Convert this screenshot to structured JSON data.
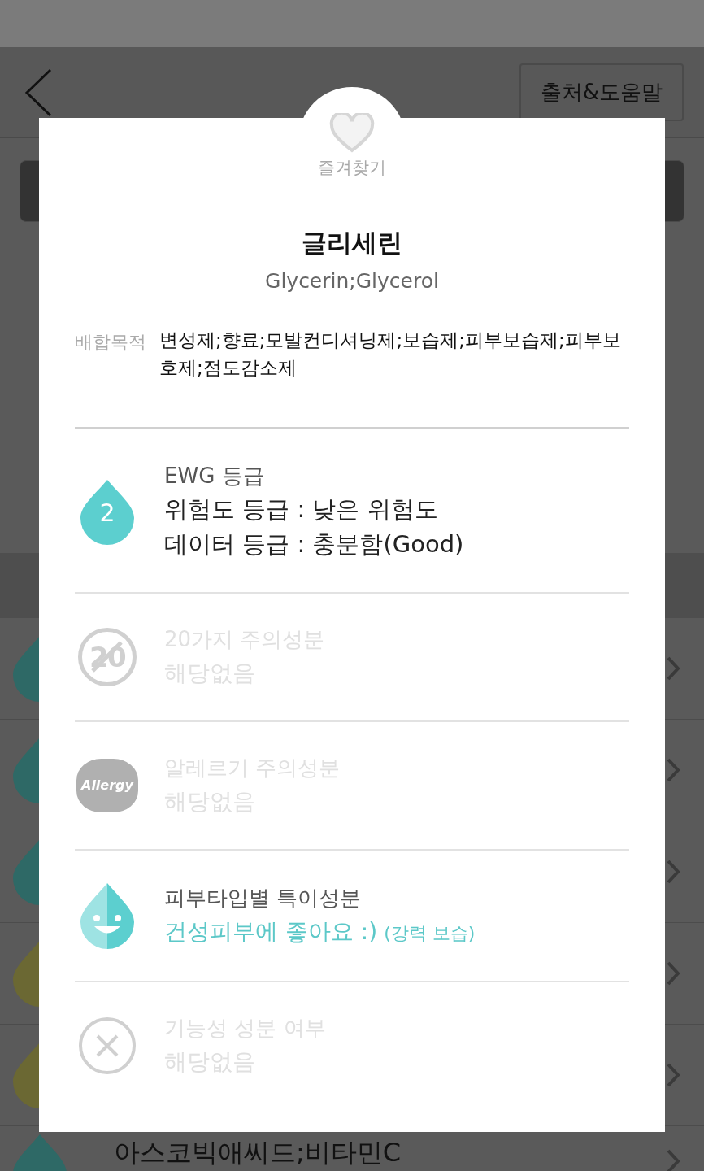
{
  "header": {
    "help_button": "출처&도움말"
  },
  "background_rows": [
    {
      "color": "#2e6966"
    },
    {
      "color": "#2e6966"
    },
    {
      "color": "#2e6966"
    },
    {
      "color": "#6b6833"
    },
    {
      "color": "#6b6833"
    },
    {
      "color": "#2e6966",
      "name": "아스코빅애씨드;비타민C"
    }
  ],
  "dialog": {
    "favorite": {
      "label": "즐겨찾기",
      "on": false
    },
    "name": "글리세린",
    "english_name": "Glycerin;Glycerol",
    "purpose": {
      "label": "배합목적",
      "value": "변성제;향료;모발컨디셔닝제;보습제;피부보습제;피부보호제;점도감소제"
    },
    "sections": [
      {
        "kind": "ewg",
        "grade": "2",
        "title": "EWG 등급",
        "lines": [
          "위험도 등급 : 낮은 위험도",
          "데이터 등급 : 충분함(Good)"
        ],
        "disabled": false
      },
      {
        "kind": "twenty",
        "icon_text": "20",
        "title": "20가지 주의성분",
        "value": "해당없음",
        "disabled": true
      },
      {
        "kind": "allergy",
        "icon_text": "Allergy",
        "title": "알레르기 주의성분",
        "value": "해당없음",
        "disabled": true
      },
      {
        "kind": "skin",
        "title": "피부타입별 특이성분",
        "value": "건성피부에 좋아요 :)",
        "note": "(강력 보습)",
        "disabled": false
      },
      {
        "kind": "functional",
        "title": "기능성 성분 여부",
        "value": "해당없음",
        "disabled": true
      }
    ]
  }
}
